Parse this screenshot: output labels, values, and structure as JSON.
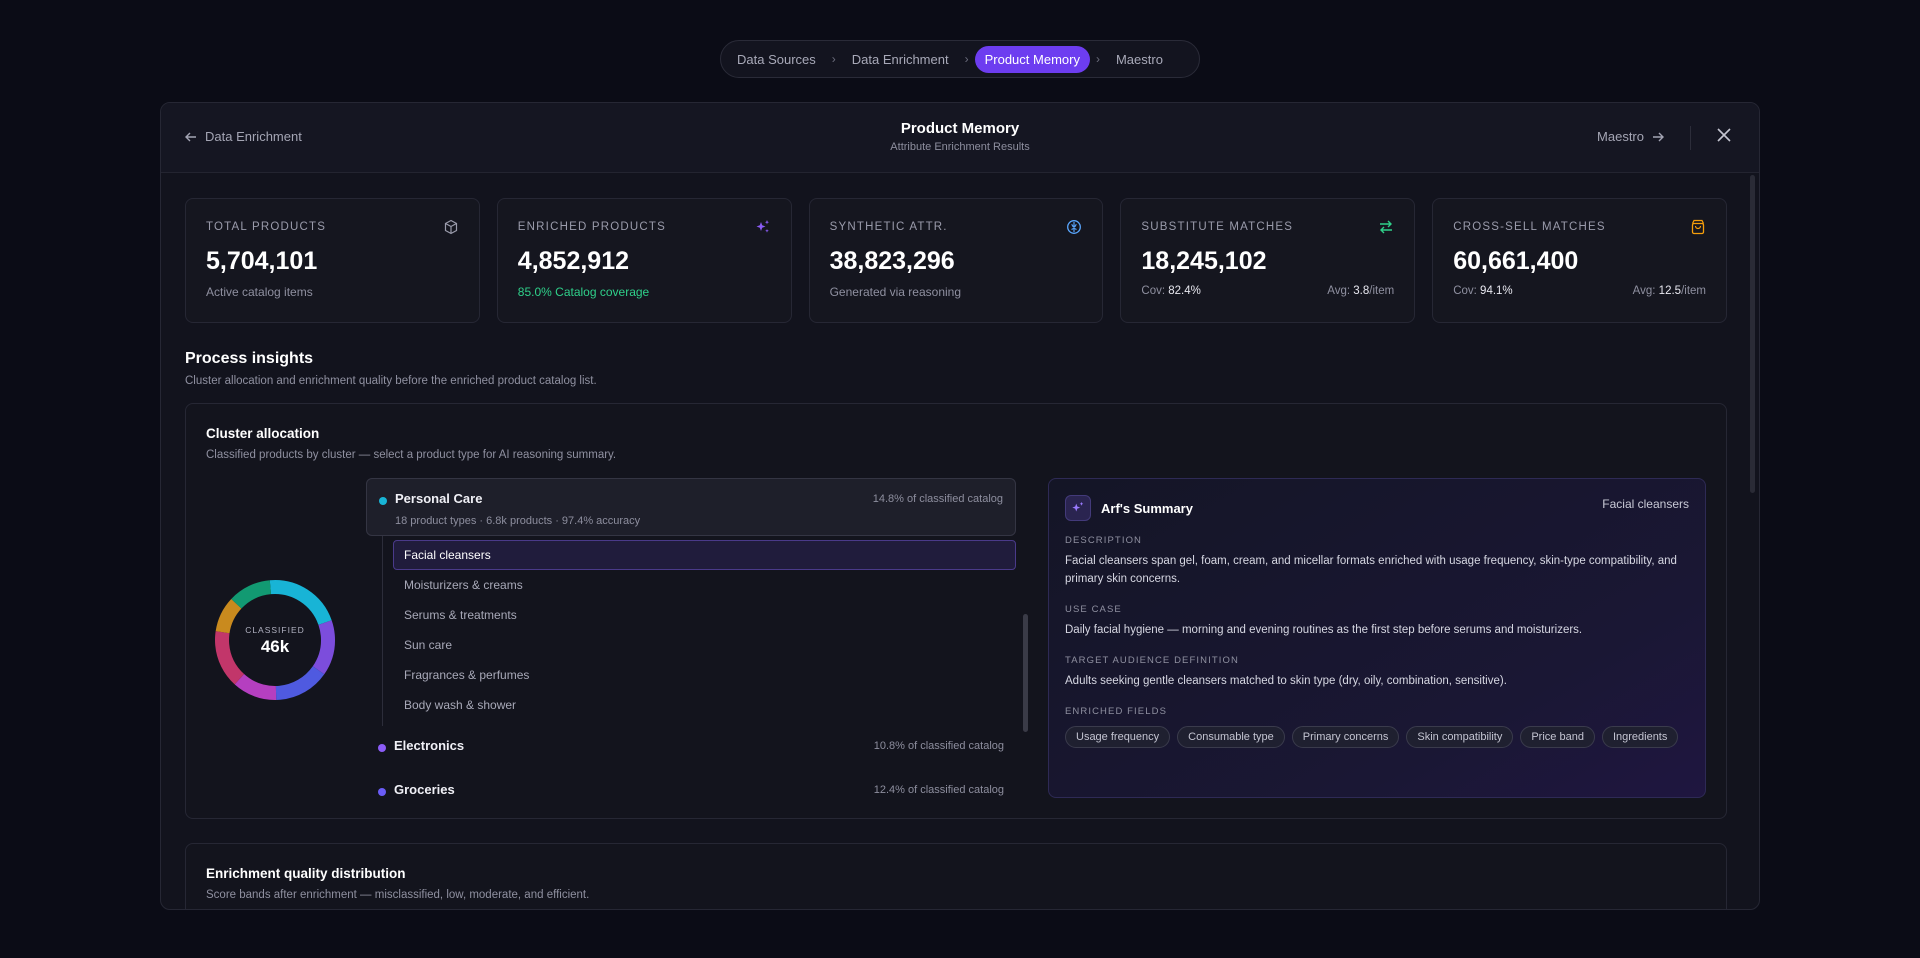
{
  "stepper": {
    "steps": [
      "Data Sources",
      "Data Enrichment",
      "Product Memory",
      "Maestro"
    ],
    "active_index": 2
  },
  "header": {
    "back_label": "Data Enrichment",
    "title": "Product Memory",
    "subtitle": "Attribute Enrichment Results",
    "forward_label": "Maestro"
  },
  "stats": [
    {
      "label": "TOTAL PRODUCTS",
      "value": "5,704,101",
      "note": "Active catalog items",
      "icon": "cube-icon"
    },
    {
      "label": "ENRICHED PRODUCTS",
      "value": "4,852,912",
      "note": "85.0% Catalog coverage",
      "icon": "sparkles-icon"
    },
    {
      "label": "SYNTHETIC ATTR.",
      "value": "38,823,296",
      "note": "Generated via reasoning",
      "icon": "brain-icon"
    },
    {
      "label": "SUBSTITUTE MATCHES",
      "value": "18,245,102",
      "cov_label": "Cov:",
      "cov_value": "82.4%",
      "avg_label": "Avg:",
      "avg_value": "3.8",
      "avg_unit": "/item",
      "icon": "swap-icon"
    },
    {
      "label": "CROSS-SELL MATCHES",
      "value": "60,661,400",
      "cov_label": "Cov:",
      "cov_value": "94.1%",
      "avg_label": "Avg:",
      "avg_value": "12.5",
      "avg_unit": "/item",
      "icon": "shopping-bag-icon"
    }
  ],
  "colors": {
    "accent": "#6d3df0",
    "green": "#2fd08a",
    "cyan": "#18b4d6",
    "purple_icon": "#8b5cf6",
    "blue_icon": "#5aa7ff",
    "orange_icon": "#f59e0b"
  },
  "insights": {
    "title": "Process insights",
    "subtitle": "Cluster allocation and enrichment quality before the enriched product catalog list."
  },
  "cluster": {
    "title": "Cluster allocation",
    "subtitle": "Classified products by cluster — select a product type for AI reasoning summary.",
    "donut_label": "CLASSIFIED",
    "donut_value": "46k",
    "items": [
      {
        "name": "Personal Care",
        "share": "14.8% of classified catalog",
        "meta": "18 product types · 6.8k products · 97.4% accuracy",
        "color": "#18b4d6"
      },
      {
        "name": "Electronics",
        "share": "10.8% of classified catalog",
        "color": "#8b5cf6"
      },
      {
        "name": "Groceries",
        "share": "12.4% of classified catalog",
        "color": "#6a5cf6"
      }
    ],
    "subtypes": [
      "Facial cleansers",
      "Moisturizers & creams",
      "Serums & treatments",
      "Sun care",
      "Fragrances & perfumes",
      "Body wash & shower"
    ],
    "selected_subtype": 0
  },
  "summary": {
    "title": "Arf's Summary",
    "type": "Facial cleansers",
    "description_label": "DESCRIPTION",
    "description": "Facial cleansers span gel, foam, cream, and micellar formats enriched with usage frequency, skin-type compatibility, and primary skin concerns.",
    "use_case_label": "USE CASE",
    "use_case": "Daily facial hygiene — morning and evening routines as the first step before serums and moisturizers.",
    "audience_label": "TARGET AUDIENCE DEFINITION",
    "audience": "Adults seeking gentle cleansers matched to skin type (dry, oily, combination, sensitive).",
    "fields_label": "ENRICHED FIELDS",
    "fields": [
      "Usage frequency",
      "Consumable type",
      "Primary concerns",
      "Skin compatibility",
      "Price band",
      "Ingredients"
    ]
  },
  "quality": {
    "title": "Enrichment quality distribution",
    "subtitle": "Score bands after enrichment — misclassified, low, moderate, and efficient."
  }
}
